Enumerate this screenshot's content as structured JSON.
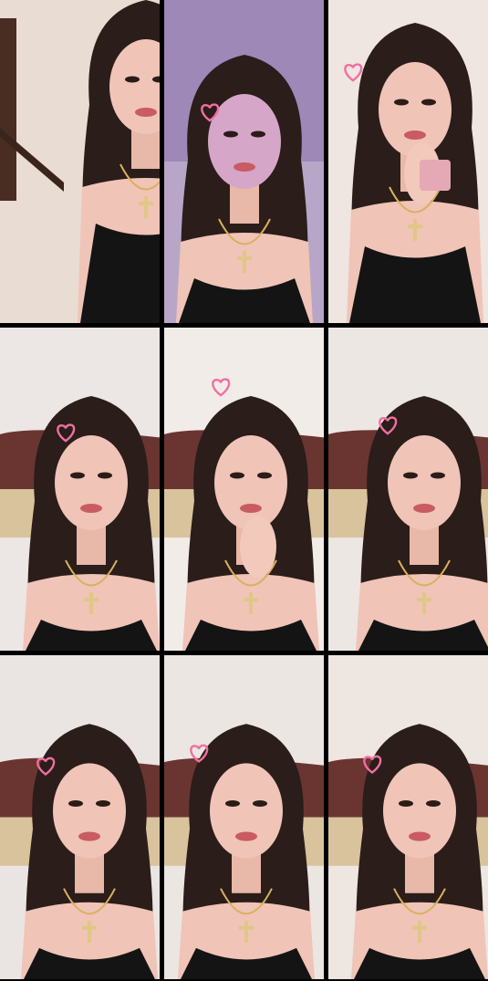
{
  "collage": {
    "tiles": [
      {
        "scene": "stairwell",
        "pose": "seated",
        "wall": "#e9dcd3",
        "accent": "#c97f70",
        "heart": false
      },
      {
        "scene": "purple-light",
        "pose": "portrait",
        "wall": "#b8a6c8",
        "accent": "#7e5fa3",
        "heart": true
      },
      {
        "scene": "lipstick",
        "pose": "closeup",
        "wall": "#efe5e1",
        "accent": "#e4a9b5",
        "heart": true
      },
      {
        "scene": "couch",
        "pose": "portrait",
        "wall": "#ece6e4",
        "accent": "#6a3530",
        "heart": true
      },
      {
        "scene": "couch",
        "pose": "finger-lips",
        "wall": "#f2ece9",
        "accent": "#6a3530",
        "heart": true
      },
      {
        "scene": "couch",
        "pose": "portrait",
        "wall": "#ece7e3",
        "accent": "#6a3530",
        "heart": true
      },
      {
        "scene": "couch",
        "pose": "portrait",
        "wall": "#eae5e3",
        "accent": "#6a3530",
        "heart": true
      },
      {
        "scene": "couch",
        "pose": "portrait-wink",
        "wall": "#ebe6e2",
        "accent": "#6a3530",
        "heart": true
      },
      {
        "scene": "couch",
        "pose": "portrait",
        "wall": "#ede6e1",
        "accent": "#6a3530",
        "heart": true
      }
    ],
    "sticker_icon": "heart-outline-icon",
    "sticker_color": "#f06fa0"
  }
}
